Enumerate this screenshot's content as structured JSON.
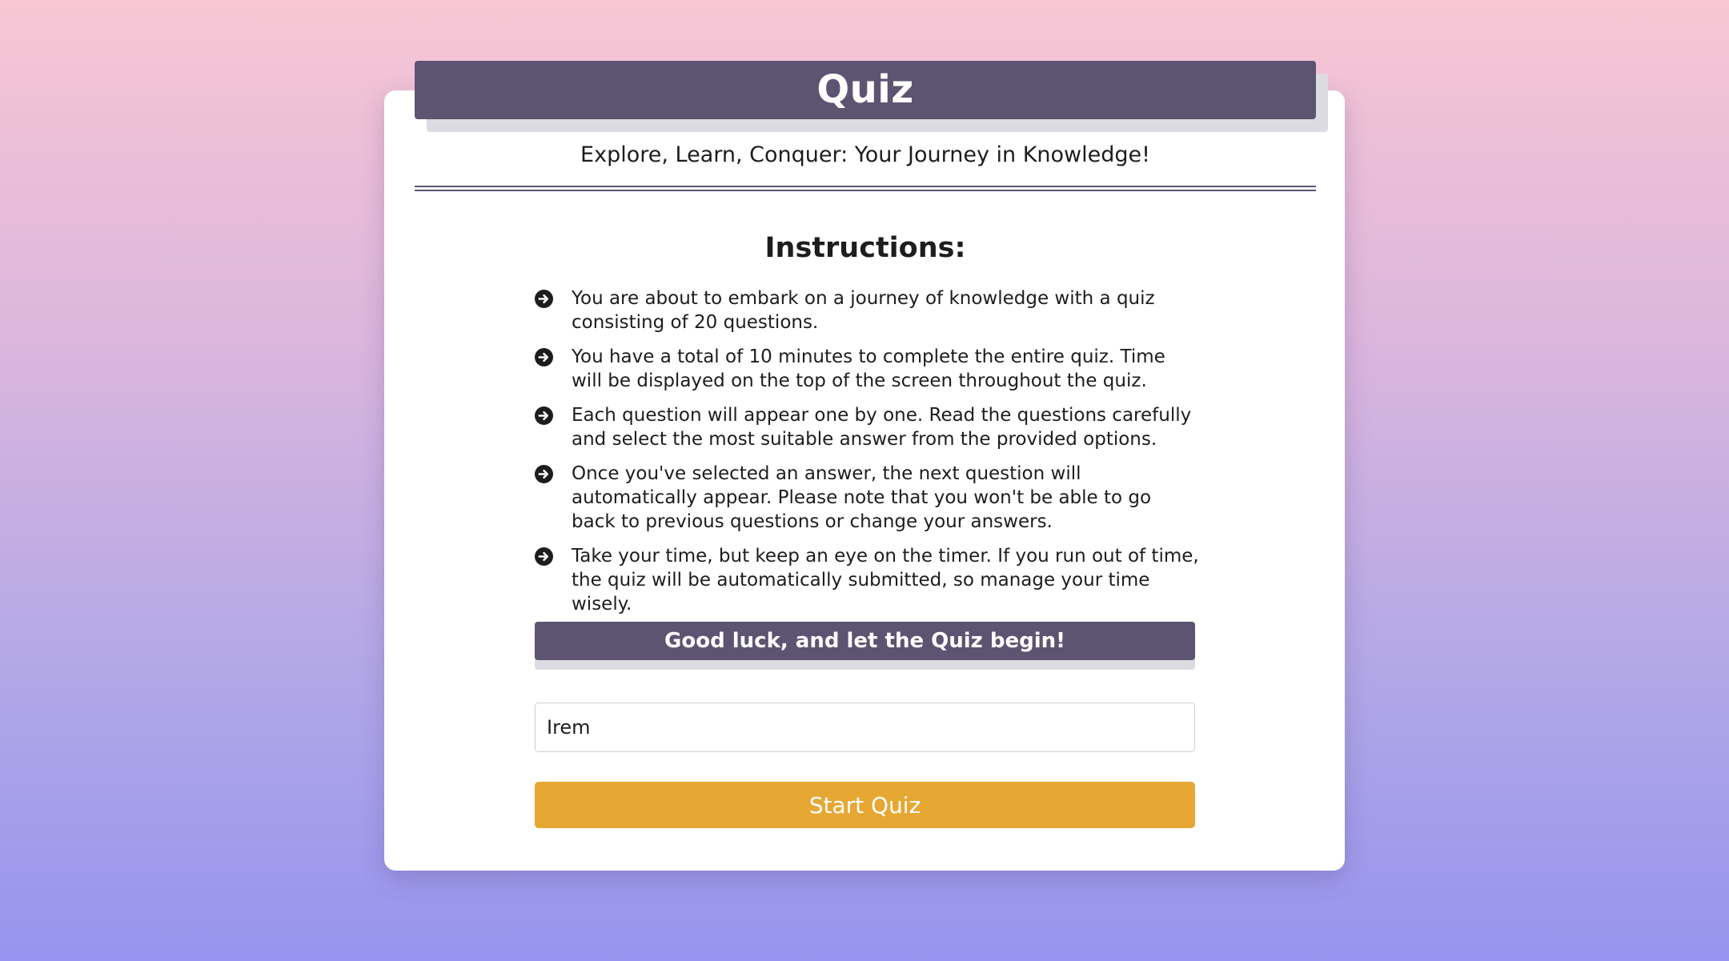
{
  "header": {
    "title": "Quiz",
    "subtitle": "Explore, Learn, Conquer: Your Journey in Knowledge!"
  },
  "instructions": {
    "heading": "Instructions:",
    "bullet_icon": "arrow-circle-right-icon",
    "items": [
      "You are about to embark on a journey of knowledge with a quiz consisting of 20 questions.",
      "You have a total of 10 minutes to complete the entire quiz. Time will be displayed on the top of the screen throughout the quiz.",
      "Each question will appear one by one. Read the questions carefully and select the most suitable answer from the provided options.",
      "Once you've selected an answer, the next question will automatically appear. Please note that you won't be able to go back to previous questions or change your answers.",
      "Take your time, but keep an eye on the timer. If you run out of time, the quiz will be automatically submitted, so manage your time wisely."
    ]
  },
  "banner": {
    "text": "Good luck, and let the Quiz begin!"
  },
  "name_input": {
    "value": "Irem"
  },
  "start_button": {
    "label": "Start Quiz"
  },
  "colors": {
    "accent_purple": "#5d5472",
    "button_gold": "#e6a733",
    "background_top": "#f8c6d4",
    "background_bottom": "#9694ee"
  }
}
